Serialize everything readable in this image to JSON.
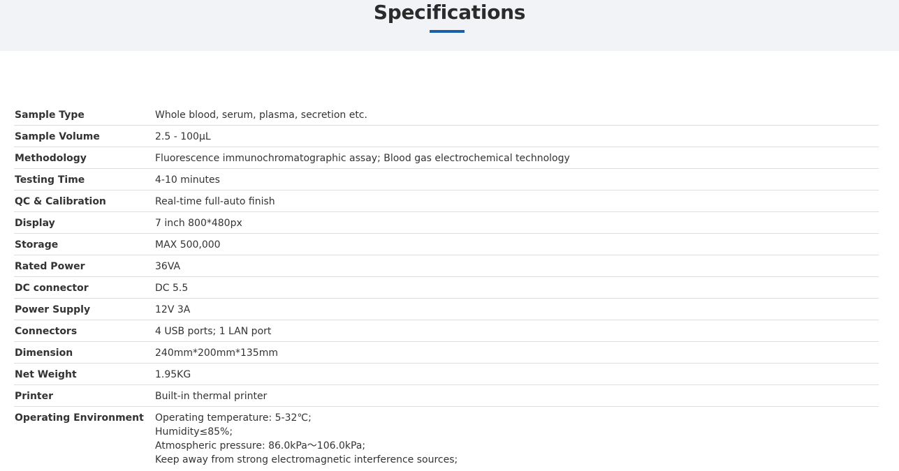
{
  "header": {
    "title": "Specifications",
    "accent_color": "#1b5fa8"
  },
  "specs": [
    {
      "label": "Sample Type",
      "value": [
        "Whole blood, serum, plasma, secretion etc."
      ]
    },
    {
      "label": "Sample Volume",
      "value": [
        "2.5 - 100μL"
      ]
    },
    {
      "label": "Methodology",
      "value": [
        "Fluorescence immunochromatographic assay; Blood gas electrochemical technology"
      ]
    },
    {
      "label": "Testing Time",
      "value": [
        "4-10 minutes"
      ]
    },
    {
      "label": "QC & Calibration",
      "value": [
        "Real-time full-auto finish"
      ]
    },
    {
      "label": "Display",
      "value": [
        "7 inch 800*480px"
      ]
    },
    {
      "label": "Storage",
      "value": [
        "MAX 500,000"
      ]
    },
    {
      "label": "Rated Power",
      "value": [
        "36VA"
      ]
    },
    {
      "label": "DC connector",
      "value": [
        "DC 5.5"
      ]
    },
    {
      "label": "Power Supply",
      "value": [
        "12V 3A"
      ]
    },
    {
      "label": "Connectors",
      "value": [
        "4 USB ports; 1 LAN port"
      ]
    },
    {
      "label": "Dimension",
      "value": [
        "240mm*200mm*135mm"
      ]
    },
    {
      "label": "Net Weight",
      "value": [
        "1.95KG"
      ]
    },
    {
      "label": "Printer",
      "value": [
        "Built-in thermal printer"
      ]
    },
    {
      "label": "Operating Environment",
      "value": [
        "Operating temperature: 5-32℃;",
        "Humidity≤85%;",
        "Atmospheric pressure: 86.0kPa～106.0kPa;",
        "Keep away from strong electromagnetic interference sources;"
      ]
    }
  ]
}
